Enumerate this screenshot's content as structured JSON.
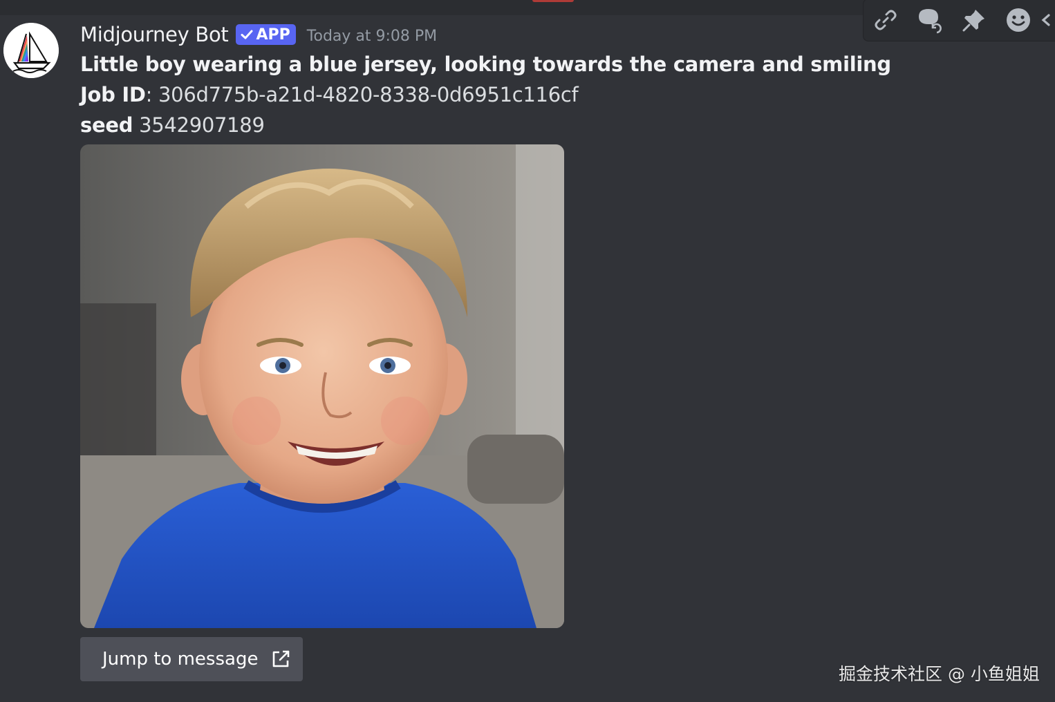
{
  "message": {
    "author": "Midjourney Bot",
    "badge": "APP",
    "timestamp": "Today at 9:08 PM",
    "prompt": "Little boy wearing a blue jersey, looking towards the camera and smiling",
    "job_id_label": "Job ID",
    "job_id_value": ": 306d775b-a21d-4820-8338-0d6951c116cf",
    "seed_label": "seed",
    "seed_value": " 3542907189",
    "image_subject": "smiling boy in blue t-shirt",
    "jump_label": "Jump to message"
  },
  "toolbar": {
    "icons": [
      "link-icon",
      "thread-icon",
      "pin-icon",
      "emoji-icon"
    ]
  },
  "watermark": "掘金技术社区 @ 小鱼姐姐",
  "colors": {
    "background": "#313338",
    "badge": "#5865f2",
    "button": "#4e5058",
    "muted": "#949ba4"
  }
}
